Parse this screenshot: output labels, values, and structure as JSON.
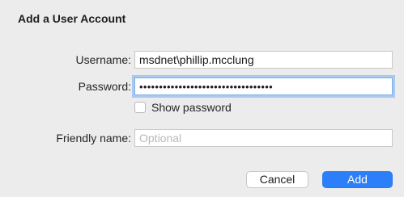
{
  "dialog": {
    "title": "Add a User Account"
  },
  "form": {
    "username_label": "Username:",
    "username_value": "msdnet\\phillip.mcclung",
    "password_label": "Password:",
    "password_masked": "••••••••••••••••••••••••••••••••••",
    "show_password_label": "Show password",
    "show_password_checked": false,
    "friendly_name_label": "Friendly name:",
    "friendly_name_placeholder": "Optional",
    "friendly_name_value": ""
  },
  "buttons": {
    "cancel_label": "Cancel",
    "add_label": "Add"
  },
  "colors": {
    "background": "#ececec",
    "accent": "#2d7ff9",
    "focus_ring": "#a9c9f0"
  }
}
